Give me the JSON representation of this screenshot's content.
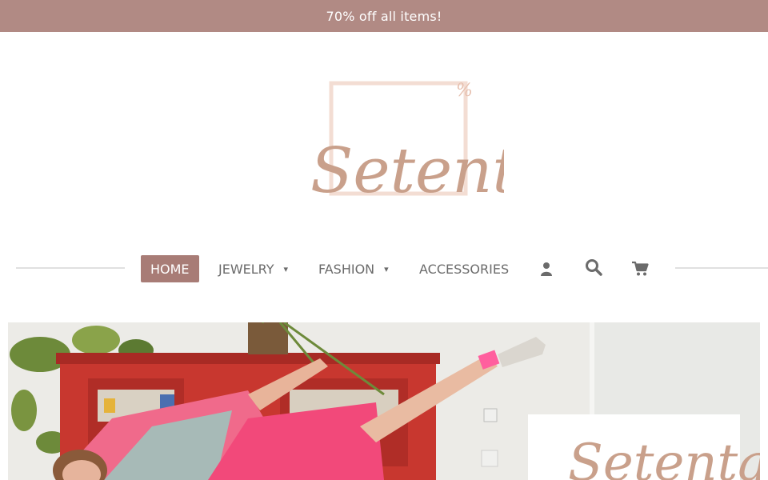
{
  "promo": {
    "text": "70% off all items!"
  },
  "brand": {
    "name": "Setenta",
    "mark": "%"
  },
  "nav": {
    "items": [
      {
        "label": "HOME",
        "active": true
      },
      {
        "label": "JEWELRY",
        "has_dropdown": true
      },
      {
        "label": "FASHION",
        "has_dropdown": true
      },
      {
        "label": "ACCESSORIES"
      }
    ],
    "icons": [
      "user-icon",
      "search-icon",
      "cart-icon"
    ],
    "caret": "▾"
  },
  "hero": {
    "card_logo_text": "Setenta"
  },
  "colors": {
    "promo_bg": "#b18a84",
    "accent": "#a87c76",
    "logo": "#c9a08b",
    "logo_frame": "#f3ddd3"
  }
}
